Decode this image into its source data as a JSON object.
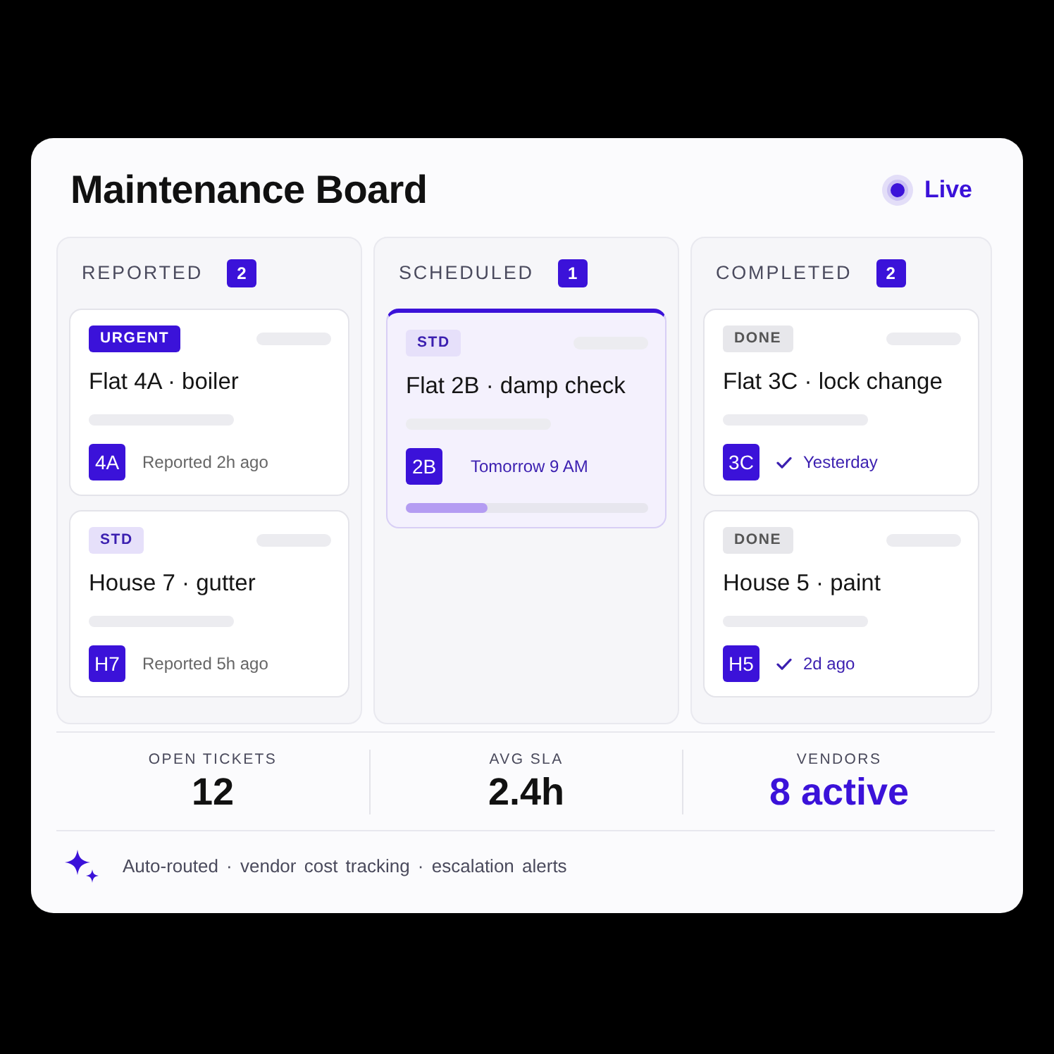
{
  "board": {
    "title": "Maintenance Board",
    "live": {
      "label": "Live"
    }
  },
  "columns": [
    {
      "title": "REPORTED",
      "count": "2",
      "tickets": [
        {
          "tag": {
            "label": "URGENT",
            "kind": "urgent"
          },
          "title": "Flat 4A · boiler",
          "avatar": "4A",
          "meta": {
            "kind": "reported",
            "text": "Reported 2h ago"
          },
          "selected": false
        },
        {
          "tag": {
            "label": "STD",
            "kind": "std"
          },
          "title": "House 7 · gutter",
          "avatar": "H7",
          "meta": {
            "kind": "reported",
            "text": "Reported 5h ago"
          },
          "selected": false
        }
      ]
    },
    {
      "title": "SCHEDULED",
      "count": "1",
      "tickets": [
        {
          "tag": {
            "label": "STD",
            "kind": "std"
          },
          "title": "Flat 2B · damp check",
          "avatar": "2B",
          "meta": {
            "kind": "scheduled",
            "text": "Tomorrow 9 AM"
          },
          "progress": {
            "level": 0.34
          },
          "selected": true
        }
      ]
    },
    {
      "title": "COMPLETED",
      "count": "2",
      "tickets": [
        {
          "tag": {
            "label": "DONE",
            "kind": "done"
          },
          "title": "Flat 3C · lock change",
          "avatar": "3C",
          "meta": {
            "kind": "completed",
            "text": "Yesterday"
          },
          "selected": false
        },
        {
          "tag": {
            "label": "DONE",
            "kind": "done"
          },
          "title": "House 5 · paint",
          "avatar": "H5",
          "meta": {
            "kind": "completed",
            "text": "2d ago"
          },
          "selected": false
        }
      ]
    }
  ],
  "stats": [
    {
      "label": "OPEN TICKETS",
      "value": "12",
      "kind": "plain"
    },
    {
      "label": "AVG SLA",
      "value": "2.4h",
      "kind": "plain"
    },
    {
      "label": "VENDORS",
      "value": "8 active",
      "kind": "accent"
    }
  ],
  "footer": {
    "text": "Auto-routed · vendor cost tracking · escalation alerts"
  }
}
